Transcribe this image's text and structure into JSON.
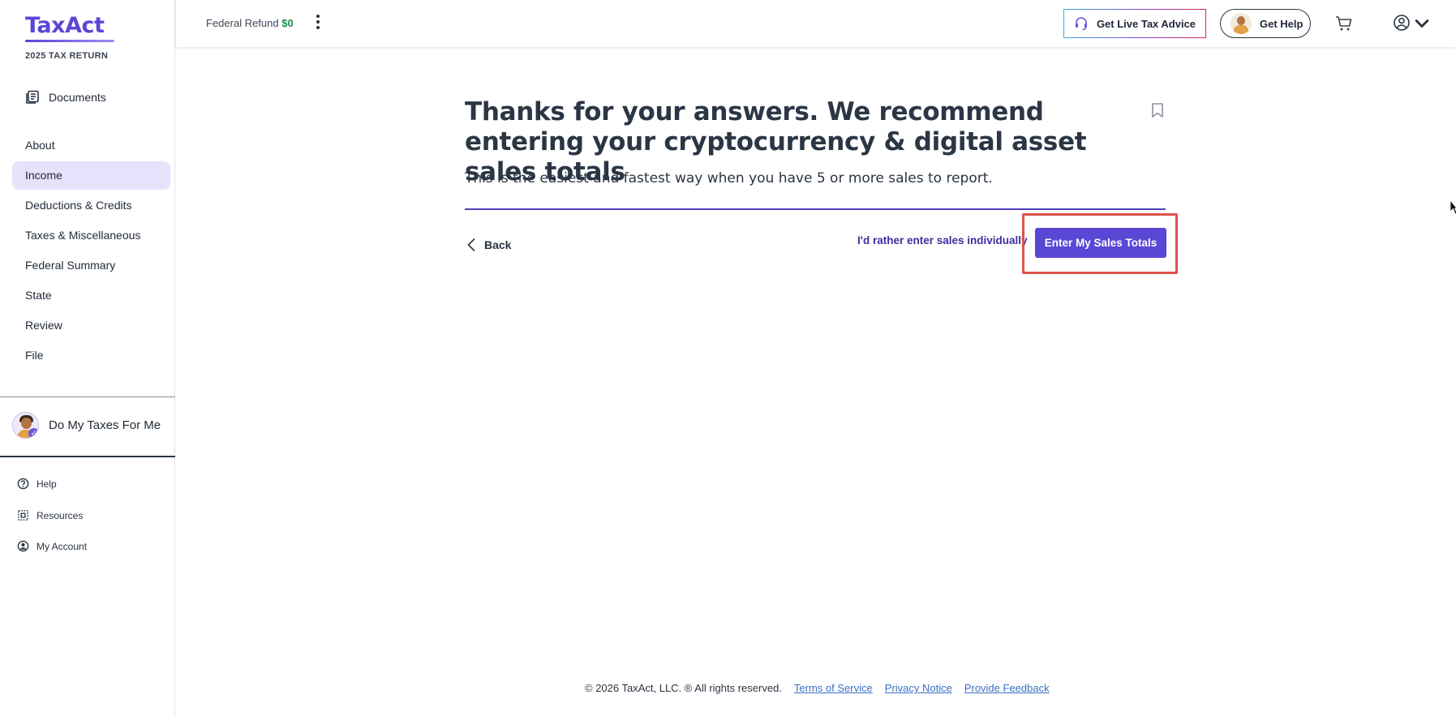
{
  "sidebar": {
    "logo": "TaxAct",
    "year_label": "2025 TAX RETURN",
    "documents": "Documents",
    "nav": [
      {
        "label": "About",
        "active": false
      },
      {
        "label": "Income",
        "active": true
      },
      {
        "label": "Deductions & Credits",
        "active": false
      },
      {
        "label": "Taxes & Miscellaneous",
        "active": false
      },
      {
        "label": "Federal Summary",
        "active": false
      },
      {
        "label": "State",
        "active": false
      },
      {
        "label": "Review",
        "active": false
      },
      {
        "label": "File",
        "active": false
      }
    ],
    "dmtfm": "Do My Taxes For Me",
    "utilities": [
      {
        "label": "Help",
        "icon": "question-circle-icon"
      },
      {
        "label": "Resources",
        "icon": "resources-icon"
      },
      {
        "label": "My Account",
        "icon": "user-circle-icon"
      }
    ]
  },
  "header": {
    "refund_label": "Federal Refund",
    "refund_amount": "$0",
    "live_advice": "Get Live Tax Advice",
    "get_help": "Get Help"
  },
  "main": {
    "title": "Thanks for your answers. We recommend entering your cryptocurrency & digital asset sales totals",
    "subtitle": "This is the easiest and fastest way when you have 5 or more sales to report.",
    "back": "Back",
    "alt_link": "I'd rather enter sales individually",
    "primary": "Enter My Sales Totals"
  },
  "footer": {
    "copyright": "© 2026 TaxAct, LLC. ® All rights reserved.",
    "terms": "Terms of Service",
    "privacy": "Privacy Notice",
    "feedback": "Provide Feedback"
  },
  "colors": {
    "brand": "#5a47d6",
    "active_nav_bg": "#e6e2fb",
    "refund_green": "#1b8a4d",
    "highlight": "#e0524a"
  }
}
